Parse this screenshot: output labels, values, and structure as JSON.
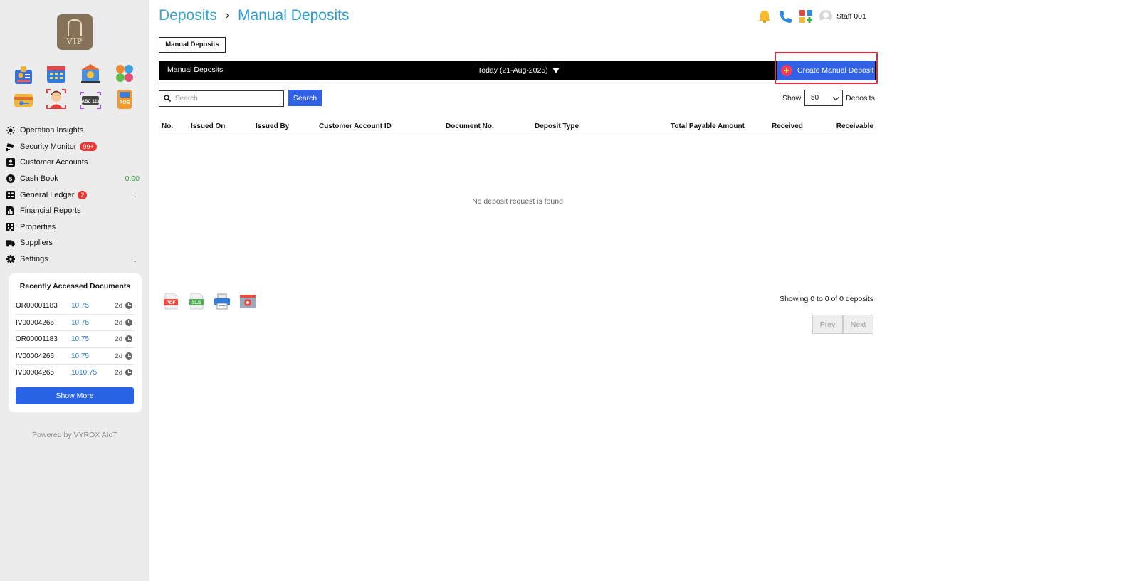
{
  "brand": {
    "logo_text": "VIP"
  },
  "sidebar": {
    "apps": [
      {
        "icon": "id-badge-icon"
      },
      {
        "icon": "calendar-icon"
      },
      {
        "icon": "bank-icon"
      },
      {
        "icon": "people-group-icon"
      },
      {
        "icon": "key-card-icon"
      },
      {
        "icon": "face-scan-icon"
      },
      {
        "icon": "ocr-scan-icon"
      },
      {
        "icon": "pos-terminal-icon"
      }
    ],
    "ocr_label": "ABC 123",
    "pos_label": "POS",
    "items": [
      {
        "label": "Operation Insights",
        "icon": "sun-icon"
      },
      {
        "label": "Security Monitor",
        "icon": "cctv-icon",
        "badge": "99+"
      },
      {
        "label": "Customer Accounts",
        "icon": "user-account-icon"
      },
      {
        "label": "Cash Book",
        "icon": "dollar-coin-icon",
        "value": "0.00"
      },
      {
        "label": "General Ledger",
        "icon": "ledger-icon",
        "badge": "2",
        "expand": "↓"
      },
      {
        "label": "Financial Reports",
        "icon": "report-icon"
      },
      {
        "label": "Properties",
        "icon": "building-icon"
      },
      {
        "label": "Suppliers",
        "icon": "truck-icon"
      },
      {
        "label": "Settings",
        "icon": "gear-icon",
        "expand": "↓"
      }
    ],
    "recent": {
      "title": "Recently Accessed Documents",
      "rows": [
        {
          "doc": "OR00001183",
          "amount": "10.75",
          "age": "2d"
        },
        {
          "doc": "IV00004266",
          "amount": "10.75",
          "age": "2d"
        },
        {
          "doc": "OR00001183",
          "amount": "10.75",
          "age": "2d"
        },
        {
          "doc": "IV00004266",
          "amount": "10.75",
          "age": "2d"
        },
        {
          "doc": "IV00004265",
          "amount": "1010.75",
          "age": "2d"
        }
      ],
      "show_more": "Show More"
    },
    "powered_by": "Powered by VYROX AIoT"
  },
  "header": {
    "breadcrumb": [
      "Deposits",
      "Manual Deposits"
    ],
    "breadcrumb_sep": "›",
    "user": "Staff 001"
  },
  "main": {
    "tab": "Manual Deposits",
    "bar_title": "Manual Deposits",
    "date_filter": "Today (21-Aug-2025)",
    "create_button": "Create Manual Deposit",
    "search": {
      "placeholder": "Search",
      "button": "Search"
    },
    "show": {
      "label": "Show",
      "value": "50",
      "suffix": "Deposits"
    },
    "columns": [
      "No.",
      "Issued On",
      "Issued By",
      "Customer Account ID",
      "Document No.",
      "Deposit Type",
      "Total Payable Amount",
      "Received",
      "Receivable"
    ],
    "empty_message": "No deposit request is found",
    "exports": [
      {
        "icon": "pdf-export-icon",
        "label": "PDF"
      },
      {
        "icon": "xls-export-icon",
        "label": "XLS"
      },
      {
        "icon": "printer-icon"
      },
      {
        "icon": "screenshot-icon"
      }
    ],
    "showing": "Showing 0 to 0 of 0 deposits",
    "pager": {
      "prev": "Prev",
      "next": "Next"
    }
  },
  "colors": {
    "accent": "#3162e6",
    "breadcrumb": "#3da6c7",
    "highlight": "#e8283a",
    "badge": "#e53935",
    "positive": "#2e9b3a",
    "link": "#2f7bd9"
  }
}
